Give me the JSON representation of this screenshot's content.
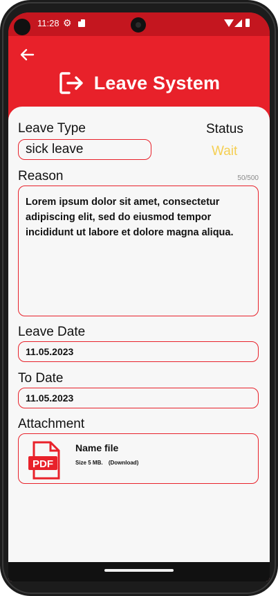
{
  "status_bar": {
    "time": "11:28"
  },
  "header": {
    "title": "Leave System"
  },
  "form": {
    "leave_type_label": "Leave Type",
    "leave_type_value": "sick leave",
    "status_label": "Status",
    "status_value": "Wait",
    "reason_label": "Reason",
    "reason_counter": "50/500",
    "reason_text": "Lorem ipsum dolor sit amet, consectetur adipiscing elit, sed do eiusmod tempor incididunt ut labore et dolore magna aliqua.",
    "leave_date_label": "Leave Date",
    "leave_date_value": "11.05.2023",
    "to_date_label": "To Date",
    "to_date_value": "11.05.2023",
    "attachment_label": "Attachment",
    "attachment": {
      "file_name": "Name file",
      "size_text": "Size 5 MB.",
      "download_text": "(Download)",
      "icon_text": "PDF"
    }
  },
  "colors": {
    "accent": "#e8212a",
    "status_wait": "#f5cf52"
  }
}
